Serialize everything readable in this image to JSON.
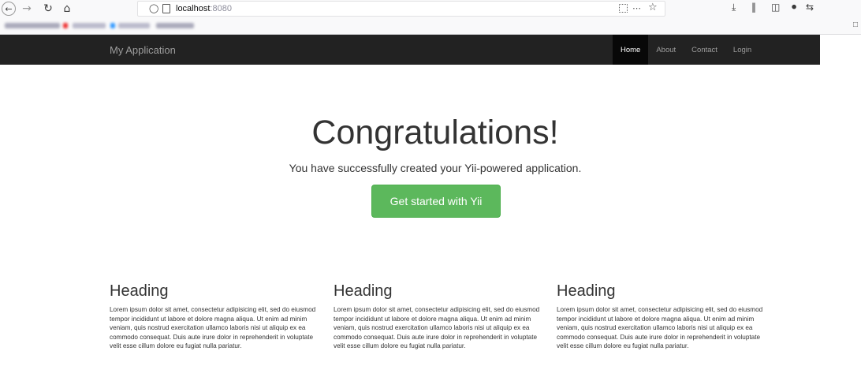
{
  "browser": {
    "url_host": "localhost",
    "url_port": ":8080",
    "icons": [
      "back-icon",
      "forward-icon",
      "reload-icon",
      "home-icon",
      "shield-icon",
      "page-icon",
      "qr-icon",
      "more-icon",
      "star-icon",
      "download-icon",
      "library-icon",
      "sidebar-icon",
      "extension-icon",
      "sync-icon"
    ]
  },
  "navbar": {
    "brand": "My Application",
    "items": [
      {
        "label": "Home",
        "active": true
      },
      {
        "label": "About",
        "active": false
      },
      {
        "label": "Contact",
        "active": false
      },
      {
        "label": "Login",
        "active": false
      }
    ]
  },
  "jumbotron": {
    "title": "Congratulations!",
    "lead": "You have successfully created your Yii-powered application.",
    "button": "Get started with Yii",
    "button_color": "#5cb85c"
  },
  "columns": [
    {
      "heading": "Heading",
      "text": "Lorem ipsum dolor sit amet, consectetur adipisicing elit, sed do eiusmod tempor incididunt ut labore et dolore magna aliqua. Ut enim ad minim veniam, quis nostrud exercitation ullamco laboris nisi ut aliquip ex ea commodo consequat. Duis aute irure dolor in reprehenderit in voluptate velit esse cillum dolore eu fugiat nulla pariatur."
    },
    {
      "heading": "Heading",
      "text": "Lorem ipsum dolor sit amet, consectetur adipisicing elit, sed do eiusmod tempor incididunt ut labore et dolore magna aliqua. Ut enim ad minim veniam, quis nostrud exercitation ullamco laboris nisi ut aliquip ex ea commodo consequat. Duis aute irure dolor in reprehenderit in voluptate velit esse cillum dolore eu fugiat nulla pariatur."
    },
    {
      "heading": "Heading",
      "text": "Lorem ipsum dolor sit amet, consectetur adipisicing elit, sed do eiusmod tempor incididunt ut labore et dolore magna aliqua. Ut enim ad minim veniam, quis nostrud exercitation ullamco laboris nisi ut aliquip ex ea commodo consequat. Duis aute irure dolor in reprehenderit in voluptate velit esse cillum dolore eu fugiat nulla pariatur."
    }
  ]
}
